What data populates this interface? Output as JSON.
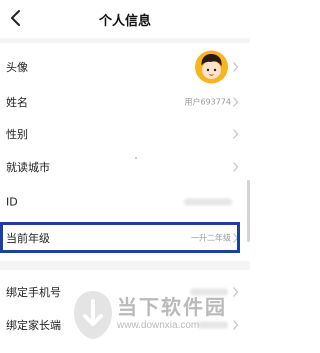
{
  "header": {
    "title": "个人信息"
  },
  "rows": [
    {
      "label": "头像"
    },
    {
      "label": "姓名",
      "value": "用户693774"
    },
    {
      "label": "性别"
    },
    {
      "label": "就读城市"
    },
    {
      "label": "ID"
    },
    {
      "label": "当前年级",
      "value": "一升二年级"
    },
    {
      "label": "绑定手机号"
    },
    {
      "label": "绑定家长端"
    }
  ],
  "watermark": {
    "title": "当下软件园",
    "url": "www.downxia.com"
  },
  "colors": {
    "highlight_border": "#1f3e9e",
    "avatar_bg": "#f6b51e"
  }
}
